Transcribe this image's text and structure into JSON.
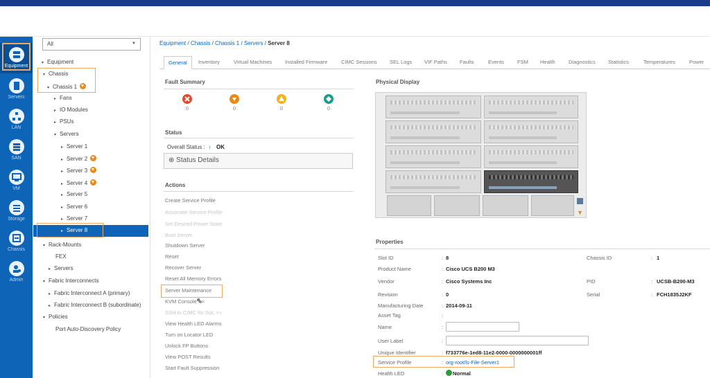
{
  "nav": {
    "items": [
      {
        "label": "Equipment",
        "icon": "equipment-icon"
      },
      {
        "label": "Servers",
        "icon": "servers-icon"
      },
      {
        "label": "LAN",
        "icon": "lan-icon"
      },
      {
        "label": "SAN",
        "icon": "san-icon"
      },
      {
        "label": "VM",
        "icon": "vm-icon"
      },
      {
        "label": "Storage",
        "icon": "storage-icon"
      },
      {
        "label": "Chassis",
        "icon": "chassis-icon"
      },
      {
        "label": "Admin",
        "icon": "admin-icon"
      }
    ]
  },
  "tree": {
    "filter": "All",
    "nodes": [
      "Equipment",
      "Chassis",
      "Chassis 1",
      "Fans",
      "IO Modules",
      "PSUs",
      "Servers",
      "Server 1",
      "Server 2",
      "Server 3",
      "Server 4",
      "Server 5",
      "Server 6",
      "Server 7",
      "Server 8",
      "Rack-Mounts",
      "FEX",
      "Servers",
      "Fabric Interconnects",
      "Fabric Interconnect A (primary)",
      "Fabric Interconnect B (subordinate)",
      "Policies",
      "Port Auto-Discovery Policy"
    ]
  },
  "breadcrumb": {
    "items": [
      "Equipment",
      "Chassis",
      "Chassis 1",
      "Servers"
    ],
    "current": "Server 8",
    "sep": "/"
  },
  "tabs": [
    "General",
    "Inventory",
    "Virtual Machines",
    "Installed Firmware",
    "CIMC Sessions",
    "SEL Logs",
    "VIF Paths",
    "Faults",
    "Events",
    "FSM",
    "Health",
    "Diagnostics",
    "Statistics",
    "Temperatures",
    "Power"
  ],
  "fault_summary": {
    "title": "Fault Summary",
    "counts": [
      "0",
      "0",
      "0",
      "0"
    ],
    "colors": [
      "#e04a2a",
      "#e8891b",
      "#f0b323",
      "#1a9c8c"
    ]
  },
  "status": {
    "title": "Status",
    "overall_label": "Overall Status :",
    "overall_value": "OK",
    "details_label": "Status Details"
  },
  "actions": {
    "title": "Actions",
    "items": [
      "Create Service Profile",
      "Associate Service Profile",
      "Set Desired Power State",
      "Boot Server",
      "Shutdown Server",
      "Reset",
      "Recover Server",
      "Reset All Memory Errors",
      "Server Maintenance",
      "KVM Console >>",
      "SSH to CIMC for SoL >>",
      "View Health LED Alarms",
      "Turn on Locator LED",
      "Unlock FP Buttons",
      "View POST Results",
      "Start Fault Suppression"
    ]
  },
  "physical": {
    "title": "Physical Display"
  },
  "properties": {
    "title": "Properties",
    "slot_id_label": "Slot ID",
    "slot_id": "8",
    "chassis_id_label": "Chassis ID",
    "chassis_id": "1",
    "product_label": "Product Name",
    "product": "Cisco UCS B200 M3",
    "vendor_label": "Vendor",
    "vendor": "Cisco Systems Inc",
    "pid_label": "PID",
    "pid": "UCSB-B200-M3",
    "revision_label": "Revision",
    "revision": "0",
    "serial_label": "Serial",
    "serial": "FCH1835J2KF",
    "mfg_label": "Manufacturing Date",
    "mfg": "2014-09-11",
    "asset_label": "Asset Tag",
    "name_label": "Name",
    "user_label_label": "User Label",
    "uuid_label": "Unique Identifier",
    "uuid": "f733776e-1ed8-11e2-0000-0000000001ff",
    "sp_label": "Service Profile",
    "sp": "org-root/ls-File-Server1",
    "led_label": "Health LED",
    "led": "Normal",
    "colon": ":"
  }
}
